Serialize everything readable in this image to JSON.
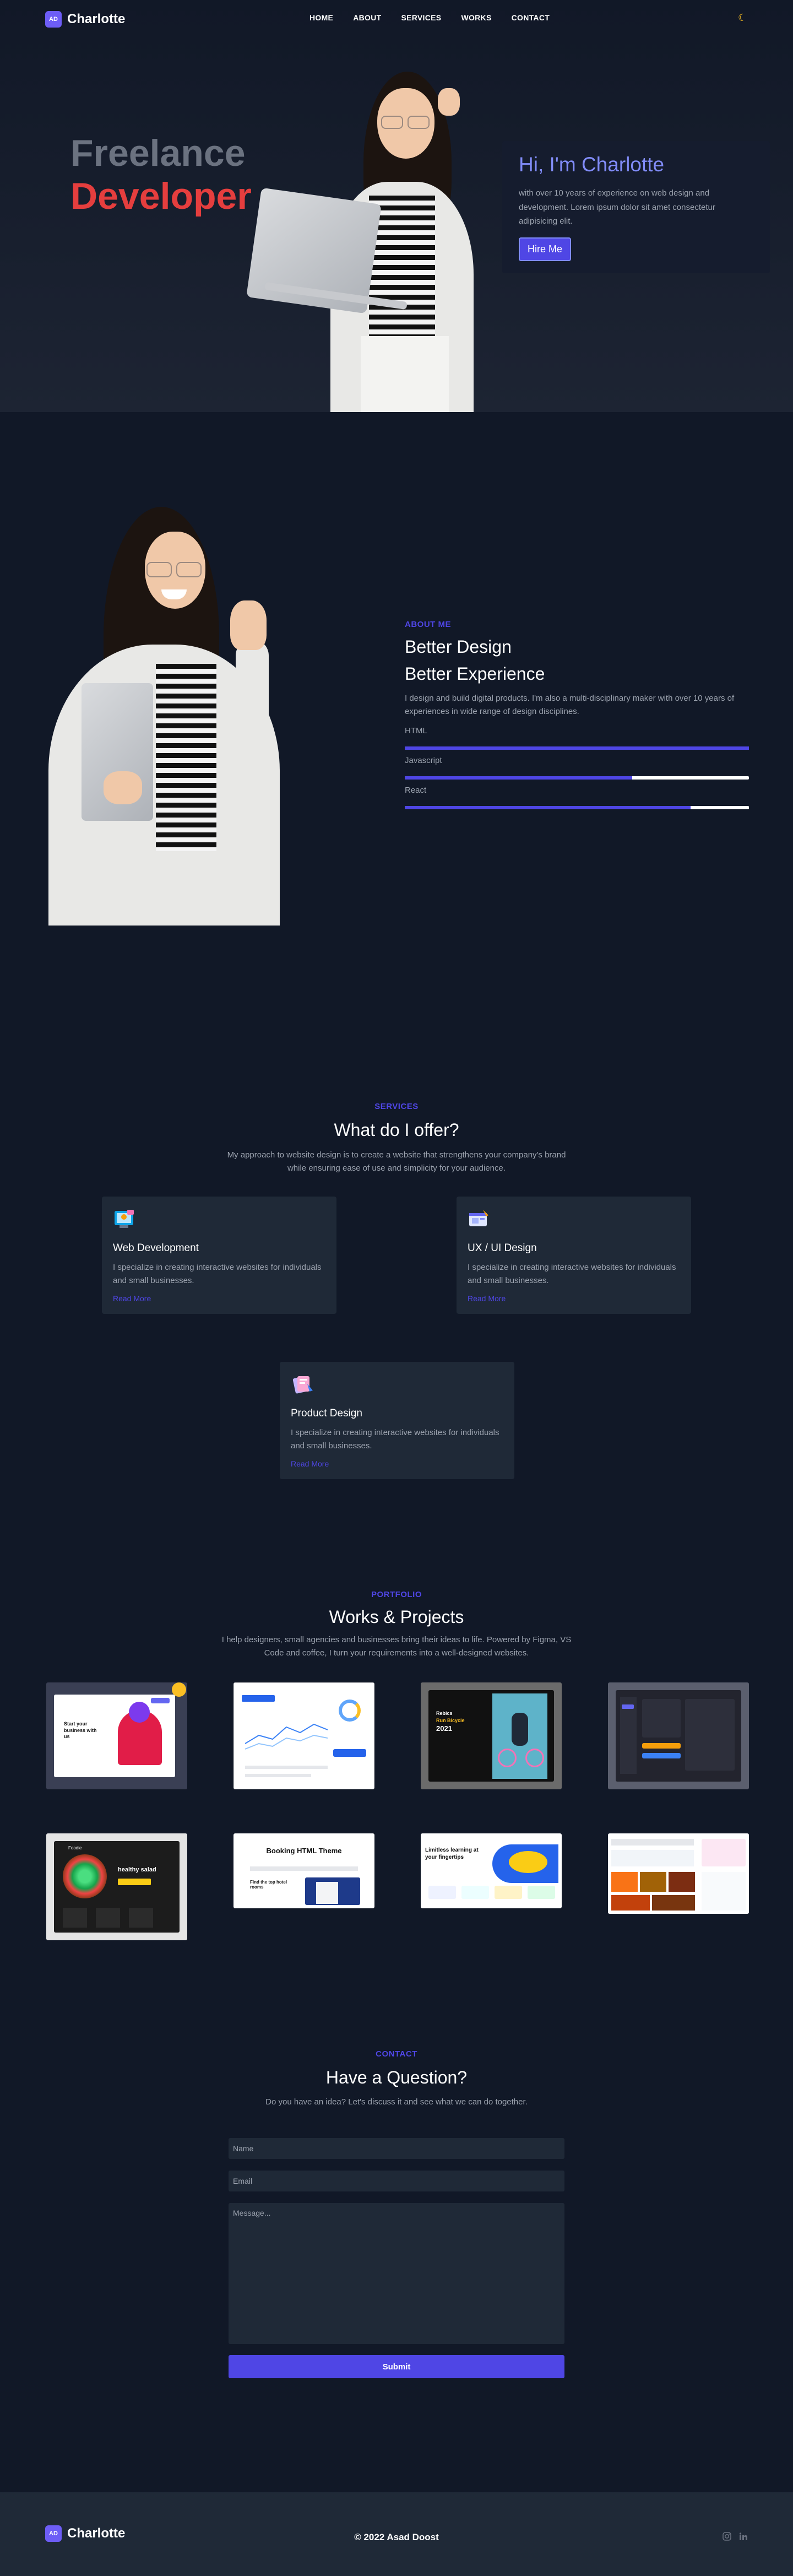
{
  "brand": {
    "logo_initials": "AD",
    "name": "Charlotte"
  },
  "nav": {
    "items": [
      "HOME",
      "ABOUT",
      "SERVICES",
      "WORKS",
      "CONTACT"
    ],
    "theme_icon": "moon-icon"
  },
  "hero": {
    "title_line1": "Freelance",
    "title_line2": "Developer",
    "greeting": "Hi, I'm Charlotte",
    "intro": "with over 10 years of experience on web design and development. Lorem ipsum dolor sit amet consectetur adipisicing elit.",
    "cta": "Hire Me"
  },
  "about": {
    "label": "ABOUT ME",
    "heading1": "Better Design",
    "heading2": "Better Experience",
    "text": "I design and build digital products. I'm also a multi-disciplinary maker with over 10 years of experiences in wide range of design disciplines.",
    "skills": [
      {
        "name": "HTML",
        "level": 1.0
      },
      {
        "name": "Javascript",
        "level": 0.66
      },
      {
        "name": "React",
        "level": 0.83
      }
    ]
  },
  "services": {
    "label": "SERVICES",
    "title": "What do I offer?",
    "description": "My approach to website design is to create a website that strengthens your company's brand while ensuring ease of use and simplicity for your audience.",
    "cards": [
      {
        "icon": "web-development-icon",
        "title": "Web Development",
        "text": "I specialize in creating interactive websites for individuals and small businesses.",
        "link": "Read More"
      },
      {
        "icon": "ux-ui-design-icon",
        "title": "UX / UI Design",
        "text": "I specialize in creating interactive websites for individuals and small businesses.",
        "link": "Read More"
      },
      {
        "icon": "product-design-icon",
        "title": "Product Design",
        "text": "I specialize in creating interactive websites for individuals and small businesses.",
        "link": "Read More"
      }
    ]
  },
  "works": {
    "label": "PORTFOLIO",
    "title": "Works & Projects",
    "description": "I help designers, small agencies and businesses bring their ideas to life. Powered by Figma, VS Code and coffee, I turn your requirements into a well-designed websites.",
    "thumbs": {
      "t1_headline": "Start your business with us",
      "t3_headline1": "Rebics",
      "t3_headline2": "Run Bicycle",
      "t3_headline3": "2021",
      "t5_title": "Foodie",
      "t5_headline": "healthy salad",
      "t6_title": "Booking HTML Theme",
      "t6_sub": "Find the top hotel rooms",
      "t7_headline": "Limitless learning at your fingertips"
    }
  },
  "contact": {
    "label": "CONTACT",
    "title": "Have a Question?",
    "description": "Do you have an idea? Let's discuss it and see what we can do together.",
    "name_placeholder": "Name",
    "email_placeholder": "Email",
    "message_placeholder": "Message...",
    "submit": "Submit"
  },
  "footer": {
    "copyright": "© 2022 Asad Doost",
    "social_icons": [
      "instagram-icon",
      "linkedin-icon"
    ]
  },
  "colors": {
    "accent": "#4f46e5",
    "accent_light": "#818cf8",
    "highlight": "#e53e3e",
    "bg": "#111827",
    "card": "#1f2937"
  }
}
